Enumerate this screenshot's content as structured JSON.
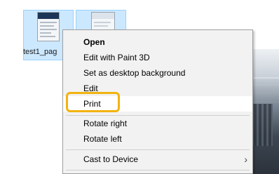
{
  "desktop": {
    "file_label": "test1_pag"
  },
  "context_menu": {
    "items": [
      {
        "label": "Open"
      },
      {
        "label": "Edit with Paint 3D"
      },
      {
        "label": "Set as desktop background"
      },
      {
        "label": "Edit"
      },
      {
        "label": "Print"
      },
      {
        "label": "Rotate right"
      },
      {
        "label": "Rotate left"
      },
      {
        "label": "Cast to Device",
        "submenu_icon": "chevron-right-icon"
      }
    ],
    "hovered_item": "Print"
  },
  "colors": {
    "menu_background": "#f2f2f2",
    "hover_background": "#ffffff",
    "highlight_outline": "#f2b30f",
    "selected_tile": "#cce8ff"
  }
}
